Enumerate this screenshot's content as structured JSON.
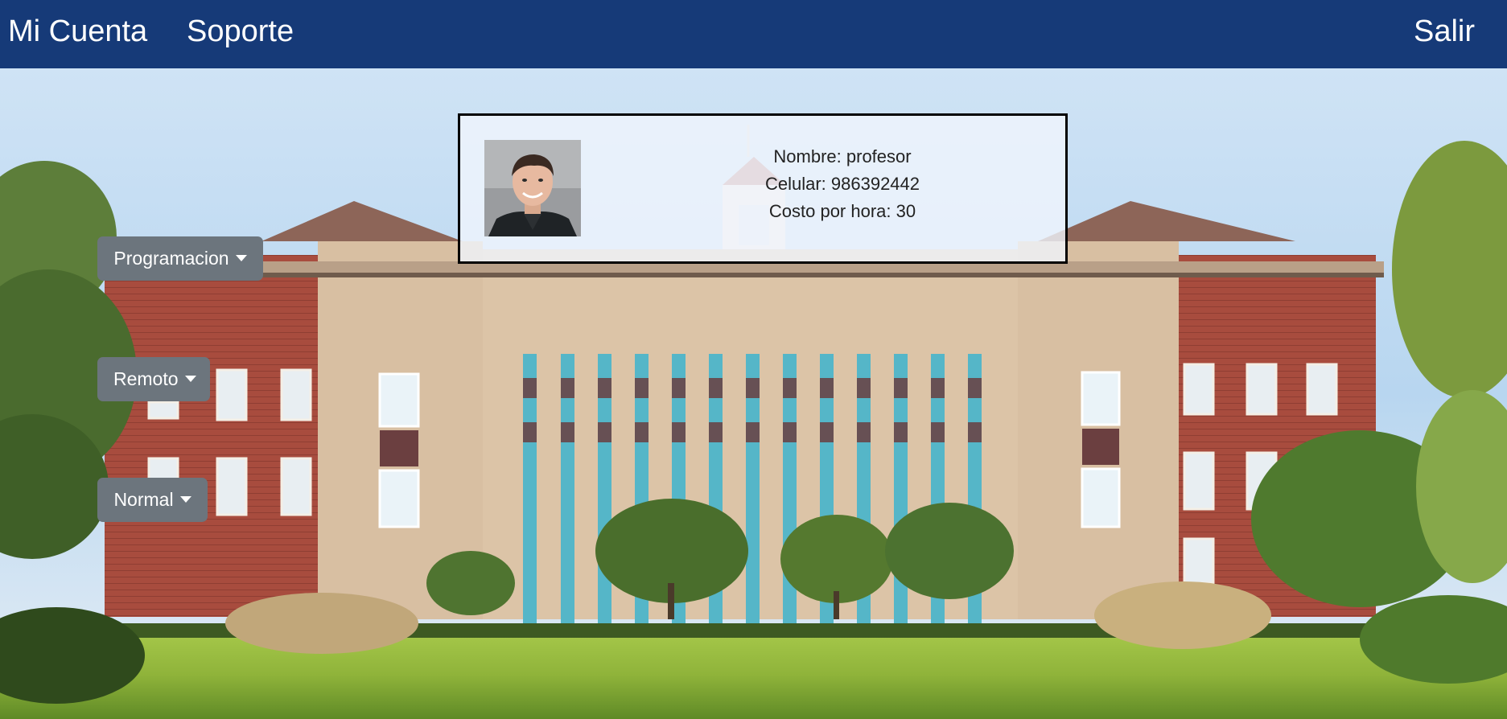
{
  "nav": {
    "mi_cuenta": "Mi Cuenta",
    "soporte": "Soporte",
    "salir": "Salir"
  },
  "profile": {
    "name_line": "Nombre: profesor",
    "phone_line": "Celular: 986392442",
    "cost_line": "Costo por hora: 30"
  },
  "dropdowns": {
    "programacion": "Programacion",
    "remoto": "Remoto",
    "normal": "Normal"
  },
  "colors": {
    "navbar": "#163a78",
    "button": "#6c757d",
    "text_light": "#ffffff"
  },
  "icons": {
    "caret": "chevron-down-icon",
    "avatar": "user-photo"
  }
}
